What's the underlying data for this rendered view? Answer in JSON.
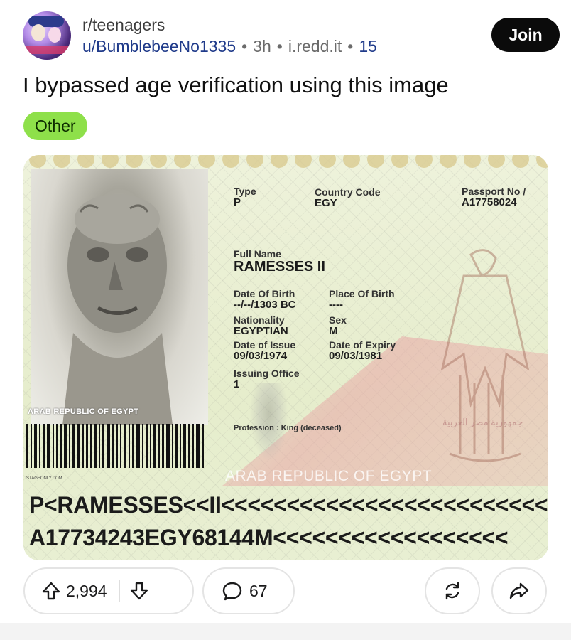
{
  "post": {
    "subreddit": "r/teenagers",
    "author": "u/BumblebeeNo1335",
    "time": "3h",
    "domain": "i.redd.it",
    "meta_count": "15",
    "join_label": "Join",
    "title": "I bypassed age verification using this image",
    "flair": "Other"
  },
  "passport": {
    "type_label": "Type",
    "type_value": "P",
    "country_code_label": "Country Code",
    "country_code_value": "EGY",
    "passport_no_label": "Passport No /",
    "passport_no_value": "A17758024",
    "full_name_label": "Full Name",
    "full_name_value": "RAMESSES II",
    "dob_label": "Date Of Birth",
    "dob_value": "--/--/1303 BC",
    "pob_label": "Place Of Birth",
    "pob_value": "----",
    "nationality_label": "Nationality",
    "nationality_value": "EGYPTIAN",
    "sex_label": "Sex",
    "sex_value": "M",
    "doi_label": "Date of Issue",
    "doi_value": "09/03/1974",
    "doe_label": "Date of Expiry",
    "doe_value": "09/03/1981",
    "office_label": "Issuing Office",
    "office_value": "1",
    "profession": "Profession : King (deceased)",
    "photo_caption": "ARAB REPUBLIC OF EGYPT",
    "watermark": "ARAB REPUBLIC OF EGYPT",
    "arabic_text": "جمهورية مصر العربية",
    "barcode_caption": "STAGEONLY.COM",
    "mrz_line1": "P<RAMESSES<<II<<<<<<<<<<<<<<<<<<<<<<<<<<",
    "mrz_line2": "A17734243EGY68144M<<<<<<<<<<<<<<<<<<"
  },
  "actions": {
    "upvotes": "2,994",
    "comments": "67",
    "icons": [
      "upvote-arrow-icon",
      "downvote-arrow-icon",
      "comment-bubble-icon",
      "crosspost-icon",
      "share-icon"
    ]
  }
}
